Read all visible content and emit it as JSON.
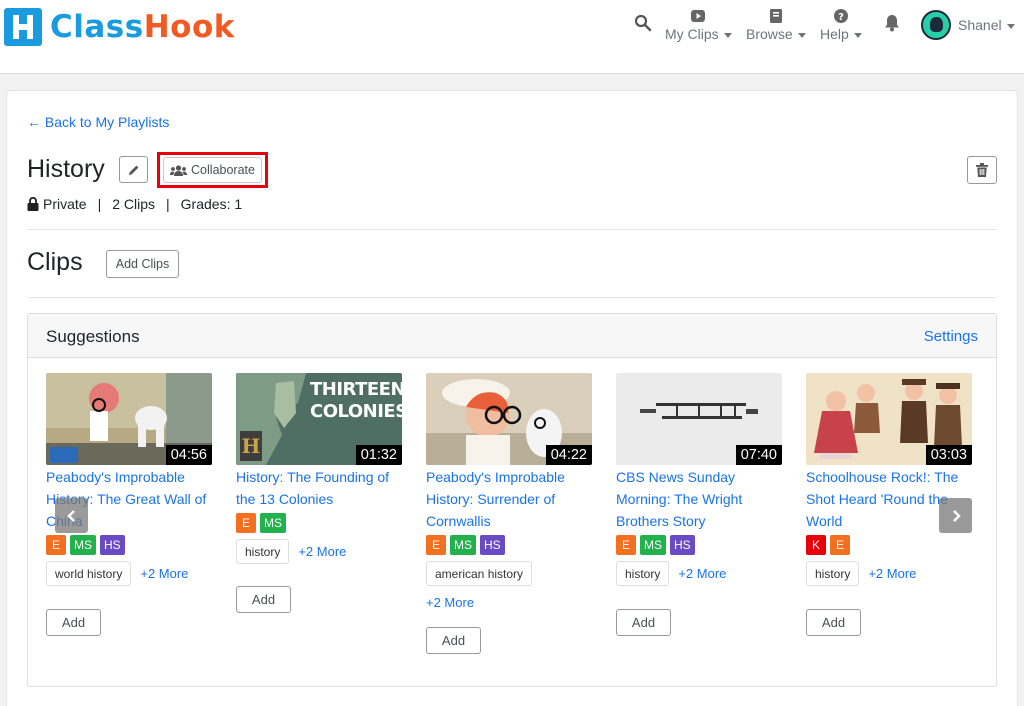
{
  "app": {
    "logo_text_a": "Class",
    "logo_text_b": "Hook",
    "brand_blue": "#1a9be0",
    "brand_orange": "#f15a22"
  },
  "nav": {
    "search_icon": "search-icon",
    "my_clips": "My Clips",
    "browse": "Browse",
    "help": "Help",
    "bell_icon": "bell-icon",
    "user": "Shanel"
  },
  "page": {
    "back_link": "← Back to My Playlists",
    "title": "History",
    "collaborate": "Collaborate",
    "privacy": "Private",
    "clips_count": "2 Clips",
    "grades": "Grades: 1"
  },
  "clips_section": {
    "title": "Clips",
    "add_clips": "Add Clips"
  },
  "suggestions": {
    "title": "Suggestions",
    "settings": "Settings",
    "items": [
      {
        "duration": "04:56",
        "title": "Peabody's Improbable History: The Great Wall of China",
        "grades": [
          "E",
          "MS",
          "HS"
        ],
        "tag": "world history",
        "more": "+2 More",
        "add": "Add"
      },
      {
        "duration": "01:32",
        "title": "History: The Founding of the 13 Colonies",
        "thumb_text_1": "THIRTEEN",
        "thumb_text_2": "COLONIES",
        "grades": [
          "E",
          "MS"
        ],
        "tag": "history",
        "more": "+2 More",
        "add": "Add"
      },
      {
        "duration": "04:22",
        "title": "Peabody's Improbable History: Surrender of Cornwallis",
        "grades": [
          "E",
          "MS",
          "HS"
        ],
        "tag": "american history",
        "more": "+2 More",
        "add": "Add"
      },
      {
        "duration": "07:40",
        "title": "CBS News Sunday Morning: The Wright Brothers Story",
        "grades": [
          "E",
          "MS",
          "HS"
        ],
        "tag": "history",
        "more": "+2 More",
        "add": "Add"
      },
      {
        "duration": "03:03",
        "title": "Schoolhouse Rock!: The Shot Heard 'Round the World",
        "grades": [
          "K",
          "E"
        ],
        "tag": "history",
        "more": "+2 More",
        "add": "Add"
      }
    ]
  },
  "grade_colors": {
    "K": "#e8000b",
    "E": "#f37021",
    "MS": "#23b14d",
    "HS": "#6a4bc4"
  }
}
